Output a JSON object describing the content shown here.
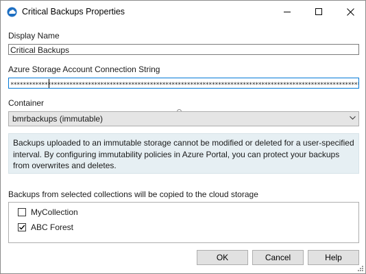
{
  "window": {
    "title": "Critical Backups Properties",
    "icon": "cloud-icon",
    "controls": {
      "minimize": "minimize-icon",
      "maximize": "maximize-icon",
      "close": "close-icon"
    }
  },
  "form": {
    "display_name_label": "Display Name",
    "display_name_value": "Critical Backups",
    "connection_string_label": "Azure Storage Account Connection String",
    "connection_string_value": "**********************************************************************************************************************************",
    "container_label": "Container",
    "container_value": "bmrbackups (immutable)",
    "info_text": "Backups uploaded to an immutable storage cannot be modified or deleted for a user-specified interval. By configuring immutability policies in Azure Portal, you can protect your backups from overwrites and deletes.",
    "collections_label": "Backups from selected collections will be copied to the cloud storage",
    "collections": [
      {
        "label": "MyCollection",
        "checked": false
      },
      {
        "label": "ABC Forest",
        "checked": true
      }
    ]
  },
  "buttons": {
    "ok": "OK",
    "cancel": "Cancel",
    "help": "Help"
  },
  "colors": {
    "accent": "#0078d7",
    "info_bg": "#e6eff3",
    "button_bg": "#e1e1e1"
  }
}
